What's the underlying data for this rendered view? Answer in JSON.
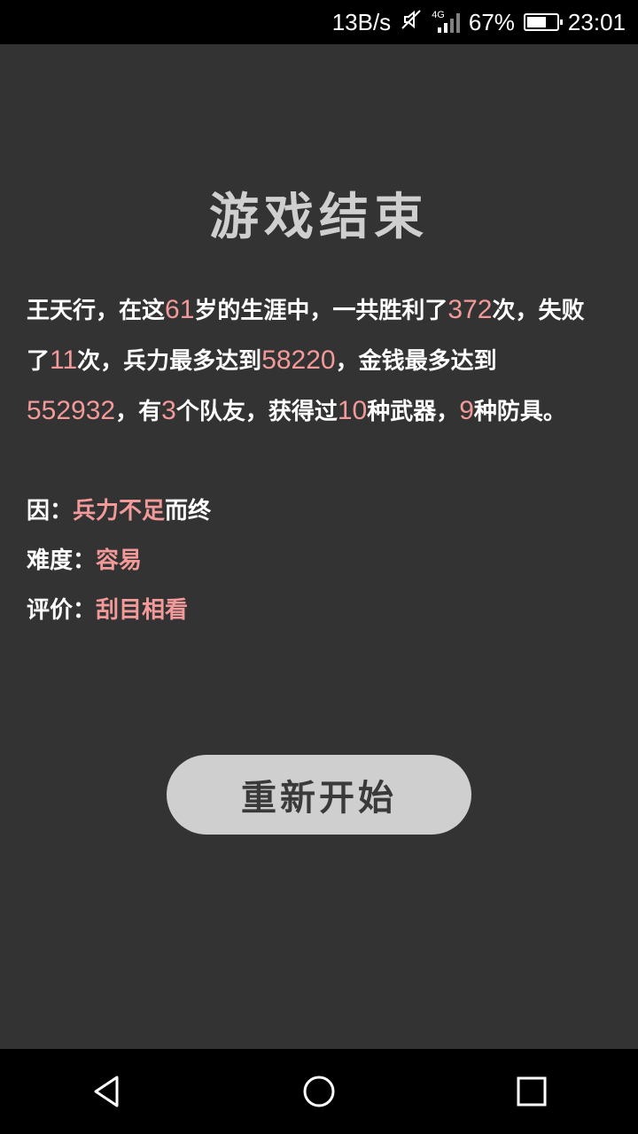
{
  "status_bar": {
    "network_speed": "13B/s",
    "network_type": "4G",
    "battery_percent": "67%",
    "battery_level": 0.67,
    "time": "23:01"
  },
  "game_over": {
    "title": "游戏结束",
    "summary": {
      "name": "王天行",
      "t_in_this": "，在这",
      "age": "61",
      "t_age_suffix": "岁的生涯中，一共胜利了",
      "wins": "372",
      "t_wins_suffix": "次，失败了",
      "losses": "11",
      "t_losses_suffix": "次，兵力最多达到",
      "max_troops": "58220",
      "t_money_prefix": "，金钱最多达到",
      "max_money": "552932",
      "t_teammates_prefix": "，有",
      "teammates": "3",
      "t_teammates_suffix": "个队友，获得过",
      "weapons": "10",
      "t_weapons_suffix": "种武器，",
      "armors": "9",
      "t_armors_suffix": "种防具。"
    },
    "cause": {
      "label": "因：",
      "value": "兵力不足",
      "suffix": "而终"
    },
    "difficulty": {
      "label": "难度：",
      "value": "容易"
    },
    "rating": {
      "label": "评价：",
      "value": "刮目相看"
    },
    "restart_label": "重新开始"
  },
  "colors": {
    "background": "#333333",
    "highlight": "#f29a9a",
    "button": "#cfcfcf"
  },
  "nav_bar": {
    "icons": [
      "back-triangle-icon",
      "home-circle-icon",
      "recents-square-icon"
    ]
  }
}
